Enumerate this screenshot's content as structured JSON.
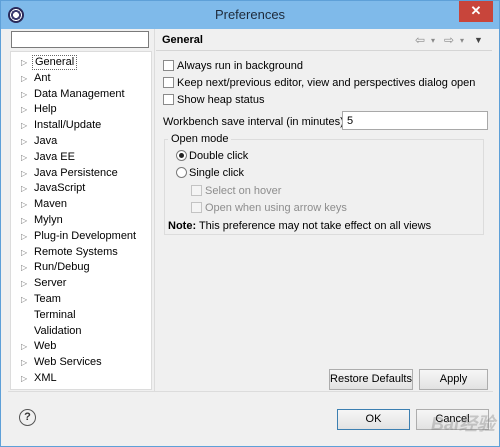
{
  "window": {
    "title": "Preferences",
    "close_glyph": "✕",
    "app_icon": "eclipse-icon"
  },
  "filter": {
    "value": "",
    "placeholder": ""
  },
  "tree": {
    "items": [
      {
        "label": "General",
        "expandable": true,
        "selected": true
      },
      {
        "label": "Ant",
        "expandable": true
      },
      {
        "label": "Data Management",
        "expandable": true
      },
      {
        "label": "Help",
        "expandable": true
      },
      {
        "label": "Install/Update",
        "expandable": true
      },
      {
        "label": "Java",
        "expandable": true
      },
      {
        "label": "Java EE",
        "expandable": true
      },
      {
        "label": "Java Persistence",
        "expandable": true
      },
      {
        "label": "JavaScript",
        "expandable": true
      },
      {
        "label": "Maven",
        "expandable": true
      },
      {
        "label": "Mylyn",
        "expandable": true
      },
      {
        "label": "Plug-in Development",
        "expandable": true
      },
      {
        "label": "Remote Systems",
        "expandable": true
      },
      {
        "label": "Run/Debug",
        "expandable": true
      },
      {
        "label": "Server",
        "expandable": true
      },
      {
        "label": "Team",
        "expandable": true
      },
      {
        "label": "Terminal",
        "expandable": false
      },
      {
        "label": "Validation",
        "expandable": false
      },
      {
        "label": "Web",
        "expandable": true
      },
      {
        "label": "Web Services",
        "expandable": true
      },
      {
        "label": "XML",
        "expandable": true
      }
    ]
  },
  "page": {
    "title": "General",
    "nav": {
      "back_glyph": "⇦",
      "forward_glyph": "⇨",
      "dropdown_glyph": "▾",
      "menu_glyph": "▼"
    },
    "options": {
      "run_background": {
        "label": "Always run in background",
        "checked": false
      },
      "keep_next_prev": {
        "label": "Keep next/previous editor, view and perspectives dialog open",
        "checked": false
      },
      "show_heap": {
        "label": "Show heap status",
        "checked": false
      }
    },
    "interval": {
      "label": "Workbench save interval (in minutes):",
      "value": "5"
    },
    "open_mode": {
      "legend": "Open mode",
      "double_click": {
        "label": "Double click",
        "selected": true
      },
      "single_click": {
        "label": "Single click",
        "selected": false
      },
      "select_on_hover": {
        "label": "Select on hover",
        "checked": false,
        "enabled": false
      },
      "open_arrow_keys": {
        "label": "Open when using arrow keys",
        "checked": false,
        "enabled": false
      }
    },
    "note": {
      "bold": "Note:",
      "text": " This preference may not take effect on all views"
    },
    "buttons": {
      "restore_defaults": "Restore Defaults",
      "apply": "Apply"
    }
  },
  "footer": {
    "help_glyph": "?",
    "ok": "OK",
    "cancel": "Cancel"
  },
  "watermark": "Bai经验"
}
